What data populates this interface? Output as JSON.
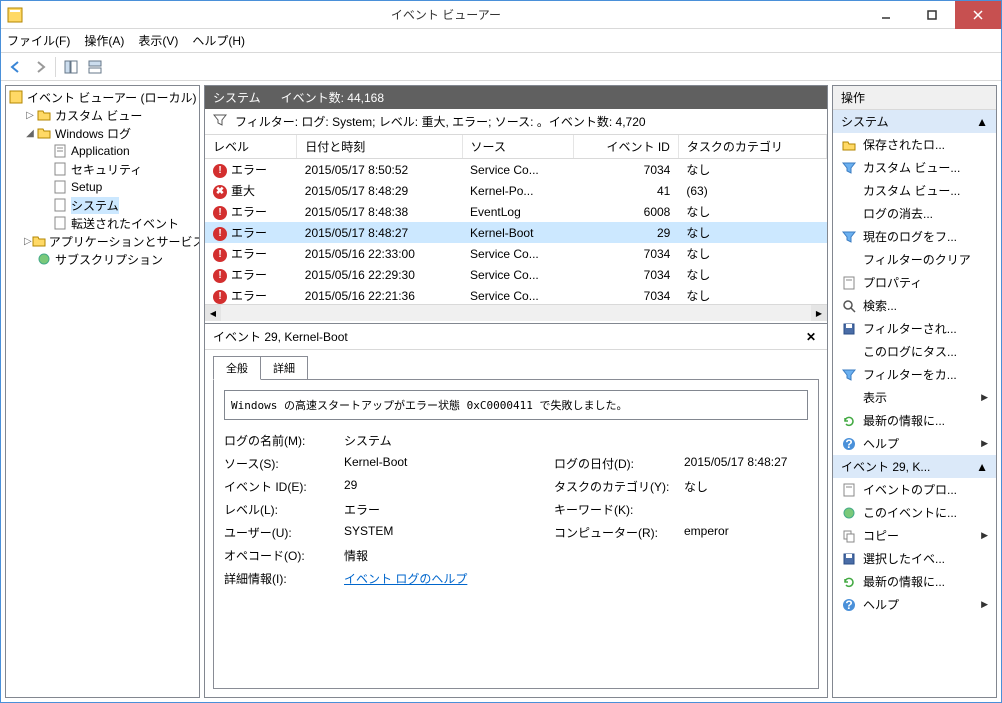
{
  "window": {
    "title": "イベント ビューアー"
  },
  "menubar": [
    "ファイル(F)",
    "操作(A)",
    "表示(V)",
    "ヘルプ(H)"
  ],
  "tree": {
    "root": "イベント ビューアー (ローカル)",
    "custom_views": "カスタム ビュー",
    "windows_log": "Windows ログ",
    "app": "Application",
    "security": "セキュリティ",
    "setup": "Setup",
    "system": "システム",
    "forwarded": "転送されたイベント",
    "app_services": "アプリケーションとサービス ログ",
    "subscriptions": "サブスクリプション"
  },
  "center": {
    "header_title": "システム",
    "header_count": "イベント数: 44,168",
    "filter_text": "フィルター: ログ: System; レベル: 重大, エラー; ソース: 。イベント数: 4,720",
    "columns": [
      "レベル",
      "日付と時刻",
      "ソース",
      "イベント ID",
      "タスクのカテゴリ"
    ],
    "rows": [
      {
        "level": "エラー",
        "lvtype": "error",
        "date": "2015/05/17 8:50:52",
        "source": "Service Co...",
        "id": "7034",
        "cat": "なし",
        "sel": false
      },
      {
        "level": "重大",
        "lvtype": "critical",
        "date": "2015/05/17 8:48:29",
        "source": "Kernel-Po...",
        "id": "41",
        "cat": "(63)",
        "sel": false
      },
      {
        "level": "エラー",
        "lvtype": "error",
        "date": "2015/05/17 8:48:38",
        "source": "EventLog",
        "id": "6008",
        "cat": "なし",
        "sel": false
      },
      {
        "level": "エラー",
        "lvtype": "error",
        "date": "2015/05/17 8:48:27",
        "source": "Kernel-Boot",
        "id": "29",
        "cat": "なし",
        "sel": true
      },
      {
        "level": "エラー",
        "lvtype": "error",
        "date": "2015/05/16 22:33:00",
        "source": "Service Co...",
        "id": "7034",
        "cat": "なし",
        "sel": false
      },
      {
        "level": "エラー",
        "lvtype": "error",
        "date": "2015/05/16 22:29:30",
        "source": "Service Co...",
        "id": "7034",
        "cat": "なし",
        "sel": false
      },
      {
        "level": "エラー",
        "lvtype": "error",
        "date": "2015/05/16 22:21:36",
        "source": "Service Co...",
        "id": "7034",
        "cat": "なし",
        "sel": false
      }
    ]
  },
  "detail": {
    "title": "イベント 29, Kernel-Boot",
    "tab_general": "全般",
    "tab_details": "詳細",
    "description": "Windows の高速スタートアップがエラー状態 0xC0000411 で失敗しました。",
    "labels": {
      "log_name": "ログの名前(M):",
      "log_name_v": "システム",
      "source": "ソース(S):",
      "source_v": "Kernel-Boot",
      "log_date": "ログの日付(D):",
      "log_date_v": "2015/05/17 8:48:27",
      "event_id": "イベント ID(E):",
      "event_id_v": "29",
      "task_cat": "タスクのカテゴリ(Y):",
      "task_cat_v": "なし",
      "level": "レベル(L):",
      "level_v": "エラー",
      "keyword": "キーワード(K):",
      "keyword_v": "",
      "user": "ユーザー(U):",
      "user_v": "SYSTEM",
      "computer": "コンピューター(R):",
      "computer_v": "emperor",
      "opcode": "オペコード(O):",
      "opcode_v": "情報",
      "more_info": "詳細情報(I):",
      "more_info_link": "イベント ログのヘルプ"
    }
  },
  "actions": {
    "title": "操作",
    "section1": "システム",
    "section2": "イベント 29, K...",
    "items1": [
      {
        "label": "保存されたロ...",
        "icon": "open"
      },
      {
        "label": "カスタム ビュー...",
        "icon": "filter-funnel"
      },
      {
        "label": "カスタム ビュー...",
        "icon": "blank"
      },
      {
        "label": "ログの消去...",
        "icon": "blank"
      },
      {
        "label": "現在のログをフ...",
        "icon": "filter-funnel"
      },
      {
        "label": "フィルターのクリア",
        "icon": "blank"
      },
      {
        "label": "プロパティ",
        "icon": "props"
      },
      {
        "label": "検索...",
        "icon": "search"
      },
      {
        "label": "フィルターされ...",
        "icon": "save"
      },
      {
        "label": "このログにタス...",
        "icon": "blank"
      },
      {
        "label": "フィルターをカ...",
        "icon": "filter-funnel"
      },
      {
        "label": "表示",
        "icon": "blank",
        "arrow": true
      },
      {
        "label": "最新の情報に...",
        "icon": "refresh"
      },
      {
        "label": "ヘルプ",
        "icon": "help",
        "arrow": true
      }
    ],
    "items2": [
      {
        "label": "イベントのプロ...",
        "icon": "props"
      },
      {
        "label": "このイベントに...",
        "icon": "task"
      },
      {
        "label": "コピー",
        "icon": "copy",
        "arrow": true
      },
      {
        "label": "選択したイベ...",
        "icon": "save"
      },
      {
        "label": "最新の情報に...",
        "icon": "refresh"
      },
      {
        "label": "ヘルプ",
        "icon": "help",
        "arrow": true
      }
    ]
  }
}
